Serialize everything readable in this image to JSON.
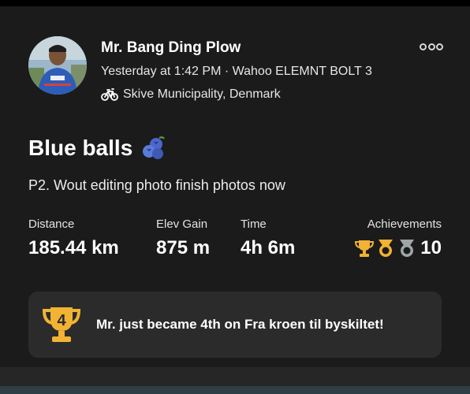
{
  "activity": {
    "athlete_name": "Mr. Bang Ding Plow",
    "meta": "Yesterday at 1:42 PM · Wahoo ELEMNT BOLT 3",
    "location": "Skive Municipality, Denmark",
    "activity_type_icon": "bike-icon",
    "title": "Blue balls",
    "title_emoji": "blueberries",
    "description": "P2. Wout editing photo finish photos now"
  },
  "stats": {
    "distance": {
      "label": "Distance",
      "value": "185.44 km"
    },
    "elev_gain": {
      "label": "Elev Gain",
      "value": "875 m"
    },
    "time": {
      "label": "Time",
      "value": "4h 6m"
    },
    "achievements": {
      "label": "Achievements",
      "value": "10",
      "icons": [
        "gold-trophy-icon",
        "gold-medal-icon",
        "silver-medal-icon"
      ]
    }
  },
  "banner": {
    "rank": "4",
    "text": "Mr. just became 4th on Fra kroen til byskiltet!"
  },
  "colors": {
    "gold": "#f2b234",
    "silver": "#9fa6a7",
    "background": "#1b1b1b",
    "banner_bg": "#2b2b2b"
  }
}
